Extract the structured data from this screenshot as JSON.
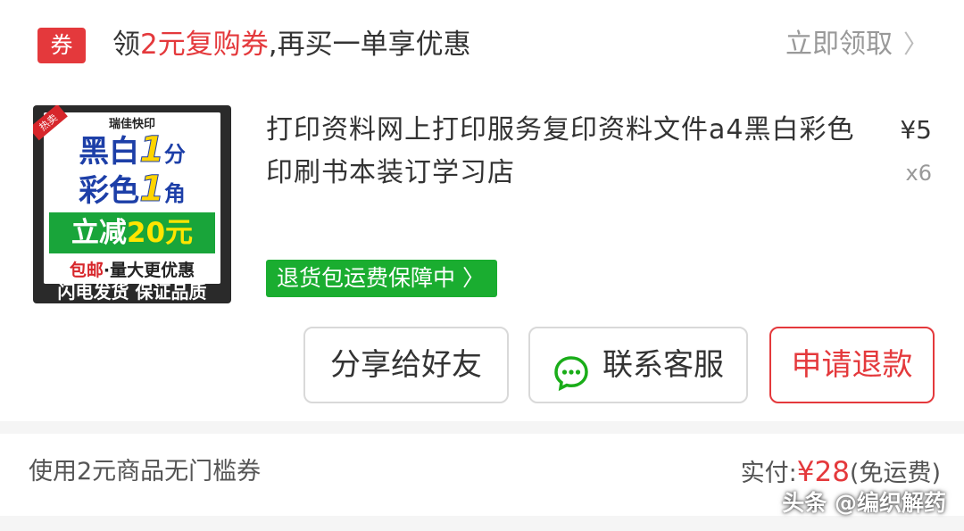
{
  "coupon": {
    "badge": "券",
    "text_prefix": "领",
    "text_highlight": "2元复购券",
    "text_suffix": ",再买一单享优惠",
    "action": "立即领取"
  },
  "product": {
    "thumbnail": {
      "brand": "瑞佳快印",
      "tag": "热卖",
      "line1_a": "黑白",
      "line1_b": "1",
      "line1_c": "分",
      "line2_a": "彩色",
      "line2_b": "1",
      "line2_c": "角",
      "promo_a": "立减",
      "promo_b": "20元",
      "ship_a": "包邮",
      "ship_b": "·量大更优惠",
      "footer": "闪电发货 保证品质"
    },
    "title": "打印资料网上打印服务复印资料文件a4黑白彩色印刷书本装订学习店",
    "price": "¥5",
    "quantity": "x6",
    "guarantee": "退货包运费保障中"
  },
  "actions": {
    "share": "分享给好友",
    "contact": "联系客服",
    "refund": "申请退款"
  },
  "summary": {
    "coupon_used": "使用2元商品无门槛券",
    "paid_label": "实付:",
    "paid_amount": "¥28",
    "shipping_note": "(免运费)"
  },
  "watermark": "头条 @编织解药",
  "colors": {
    "accent": "#e4393c",
    "guarantee_green": "#1aad30"
  }
}
